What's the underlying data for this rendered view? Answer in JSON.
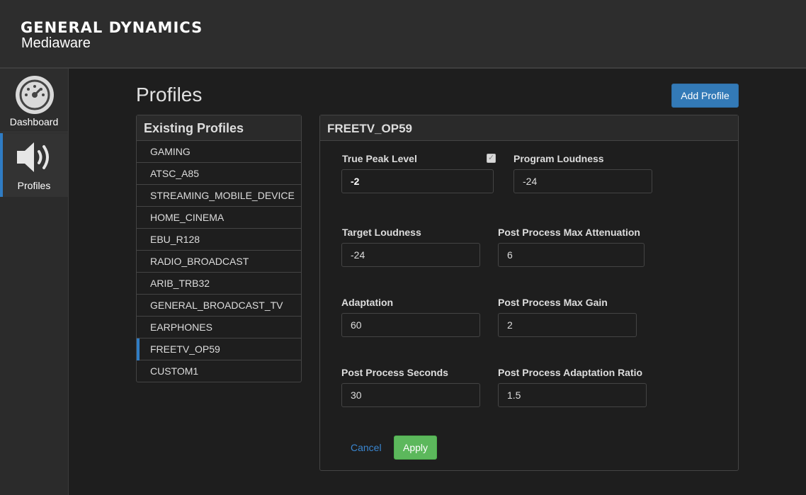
{
  "brand": {
    "name": "GENERAL DYNAMICS",
    "product": "Mediaware"
  },
  "sidebar": {
    "items": [
      {
        "label": "Dashboard",
        "icon": "gauge-icon"
      },
      {
        "label": "Profiles",
        "icon": "speaker-icon",
        "active": true
      }
    ]
  },
  "page": {
    "title": "Profiles",
    "add_label": "Add Profile"
  },
  "profiles": {
    "heading": "Existing Profiles",
    "items": [
      "GAMING",
      "ATSC_A85",
      "STREAMING_MOBILE_DEVICE",
      "HOME_CINEMA",
      "EBU_R128",
      "RADIO_BROADCAST",
      "ARIB_TRB32",
      "GENERAL_BROADCAST_TV",
      "EARPHONES",
      "FREETV_OP59",
      "CUSTOM1"
    ],
    "selected": "FREETV_OP59"
  },
  "form": {
    "title": "FREETV_OP59",
    "true_peak_level": {
      "label": "True Peak Level",
      "value": "-2",
      "checked": true
    },
    "program_loudness": {
      "label": "Program Loudness",
      "value": "-24"
    },
    "target_loudness": {
      "label": "Target Loudness",
      "value": "-24"
    },
    "pp_max_attenuation": {
      "label": "Post Process Max Attenuation",
      "value": "6"
    },
    "adaptation": {
      "label": "Adaptation",
      "value": "60"
    },
    "pp_max_gain": {
      "label": "Post Process Max Gain",
      "value": "2"
    },
    "pp_seconds": {
      "label": "Post Process Seconds",
      "value": "30"
    },
    "pp_adaptation_ratio": {
      "label": "Post Process Adaptation Ratio",
      "value": "1.5"
    },
    "cancel_label": "Cancel",
    "apply_label": "Apply"
  },
  "colors": {
    "accent": "#337ab7",
    "apply": "#5cb85c",
    "active_marker": "#2f7cc4"
  }
}
